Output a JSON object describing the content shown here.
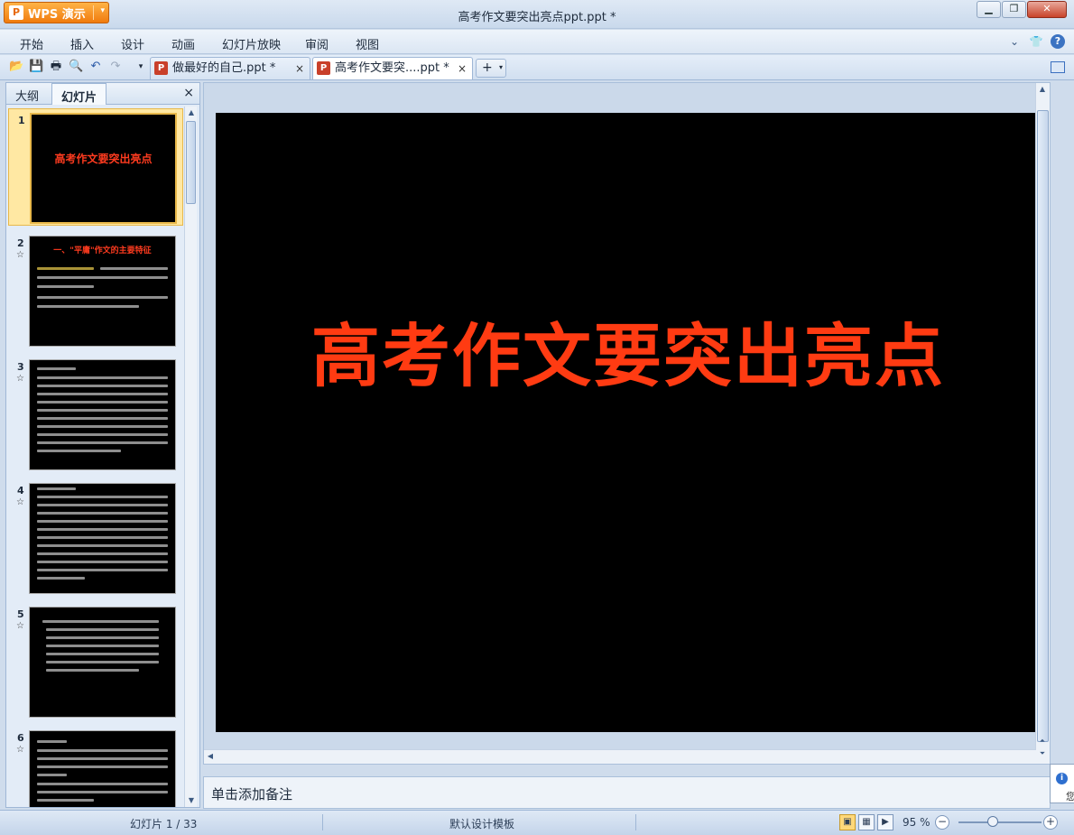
{
  "app": {
    "name": "WPS 演示",
    "logo_char": "P"
  },
  "window": {
    "title": "高考作文要突出亮点ppt.ppt *"
  },
  "menu": [
    "开始",
    "插入",
    "设计",
    "动画",
    "幻灯片放映",
    "审阅",
    "视图"
  ],
  "menu_right_icons": [
    "chevron-down-icon",
    "shirt-icon",
    "help-icon"
  ],
  "tabs": [
    {
      "label": "做最好的自己.ppt *",
      "active": false
    },
    {
      "label": "高考作文要突....ppt *",
      "active": true
    }
  ],
  "left_panel": {
    "tabs": [
      "大纲",
      "幻灯片"
    ],
    "active_tab": "幻灯片",
    "slides": [
      {
        "num": "1",
        "title": "高考作文要突出亮点",
        "selected": true
      },
      {
        "num": "2",
        "title": "一、\"平庸\"作文的主要特征"
      },
      {
        "num": "3"
      },
      {
        "num": "4"
      },
      {
        "num": "5"
      },
      {
        "num": "6"
      }
    ]
  },
  "slide": {
    "title": "高考作文要突出亮点",
    "title_color": "#ff3b12"
  },
  "notes": {
    "placeholder": "单击添加备注"
  },
  "status": {
    "slide_counter": "幻灯片 1 / 33",
    "template": "默认设计模板",
    "zoom": "95 %"
  },
  "popup": {
    "text": "您"
  },
  "colors": {
    "accent": "#f07b0d",
    "slide_bg": "#000000",
    "title_red": "#ff3b12"
  }
}
